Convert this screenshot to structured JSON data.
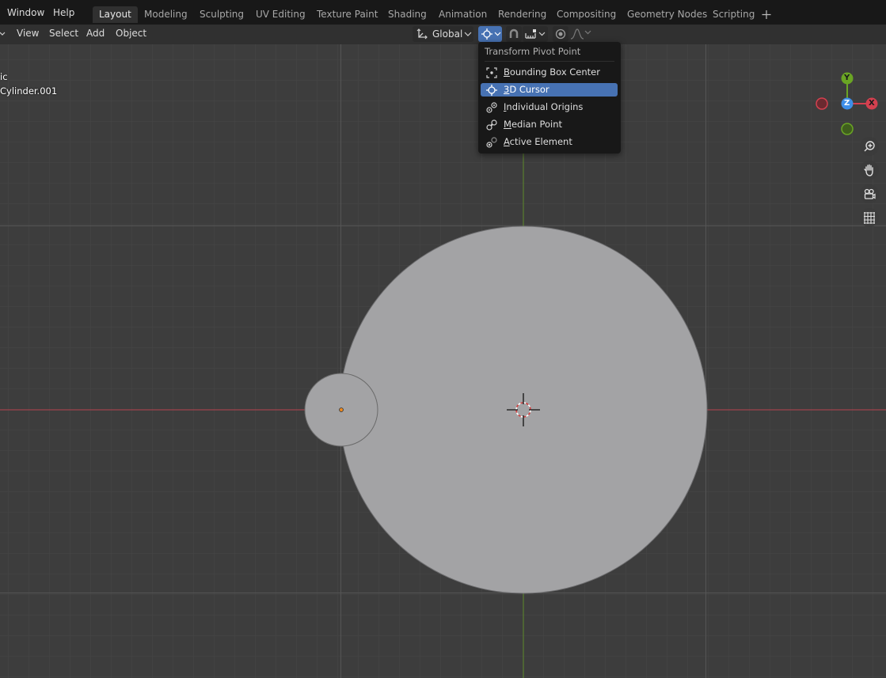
{
  "topbar": {
    "menus": [
      "Window",
      "Help"
    ],
    "tabs": [
      "Layout",
      "Modeling",
      "Sculpting",
      "UV Editing",
      "Texture Paint",
      "Shading",
      "Animation",
      "Rendering",
      "Compositing",
      "Geometry Nodes",
      "Scripting"
    ],
    "active_tab": "Layout",
    "add_tab_icon": "plus-icon"
  },
  "header": {
    "menus": [
      "View",
      "Select",
      "Add",
      "Object"
    ],
    "orientation": "Global",
    "pivot_icon": "3d-cursor-icon",
    "snap_icon": "magnet-icon",
    "proportional_icon": "proportional-edit-icon"
  },
  "viewport": {
    "overlay_line1": "ic",
    "overlay_line2": "Cylinder.001",
    "gizmo": {
      "y": "Y",
      "z": "Z",
      "x": "X"
    },
    "colors": {
      "x_axis": "#d4404f",
      "y_axis": "#6aa524",
      "z_axis": "#3d8ee8",
      "object": "#a3a3a5",
      "grid_bg": "#3d3d3d",
      "selection_accent": "#4772b3"
    }
  },
  "pivot_menu": {
    "title": "Transform Pivot Point",
    "items": [
      {
        "label": "Bounding Box Center",
        "icon": "bounding-box-center-icon",
        "selected": false
      },
      {
        "label": "3D Cursor",
        "icon": "3d-cursor-icon",
        "selected": true
      },
      {
        "label": "Individual Origins",
        "icon": "individual-origins-icon",
        "selected": false
      },
      {
        "label": "Median Point",
        "icon": "median-point-icon",
        "selected": false
      },
      {
        "label": "Active Element",
        "icon": "active-element-icon",
        "selected": false
      }
    ]
  }
}
